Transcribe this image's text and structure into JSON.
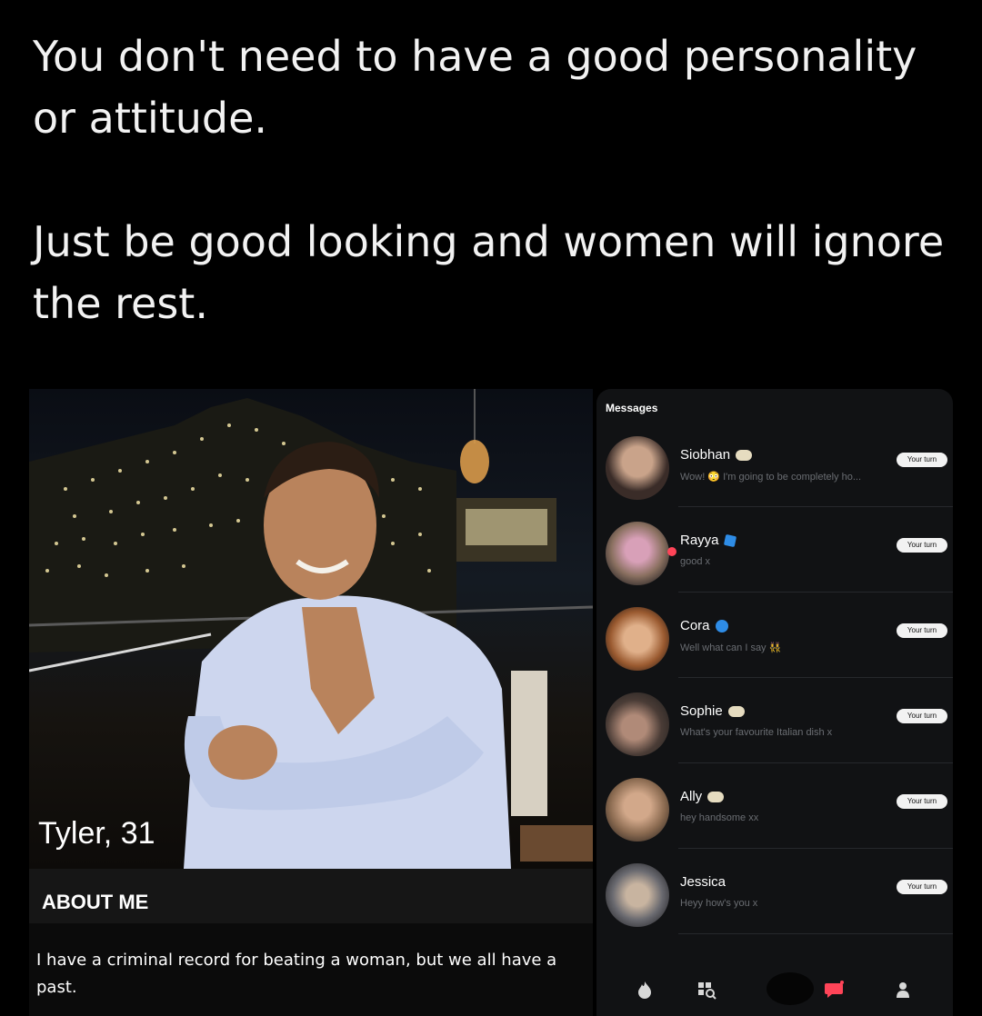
{
  "tweet": {
    "line1": "You don't need to have a good personality or attitude.",
    "line2": "Just be good looking and women will ignore the rest."
  },
  "profile": {
    "name_age": "Tyler, 31",
    "about_title": "ABOUT ME",
    "about_text": "I have a criminal record for beating a woman, but we all have a past."
  },
  "messages": {
    "title": "Messages",
    "turn_label": "Your turn",
    "conversations": [
      {
        "name": "Siobhan",
        "badge": "cream",
        "preview": "Wow! 😳 I'm going to be completely ho..."
      },
      {
        "name": "Rayya",
        "badge": "verified",
        "preview": "good x"
      },
      {
        "name": "Cora",
        "badge": "blue",
        "preview": "Well what can I say 👯‍♀️"
      },
      {
        "name": "Sophie",
        "badge": "cream",
        "preview": "What's your favourite Italian dish x"
      },
      {
        "name": "Ally",
        "badge": "cream",
        "preview": "hey handsome xx"
      },
      {
        "name": "Jessica",
        "badge": "none",
        "preview": "Heyy how's you x"
      }
    ]
  },
  "colors": {
    "background": "#000000",
    "panel": "#111214",
    "preview_text": "#6a6d72",
    "unread_dot": "#ff4458",
    "verified": "#2e8ce6"
  },
  "icons": [
    "flame-icon",
    "explore-icon",
    "likes-icon",
    "chat-icon",
    "profile-icon"
  ]
}
